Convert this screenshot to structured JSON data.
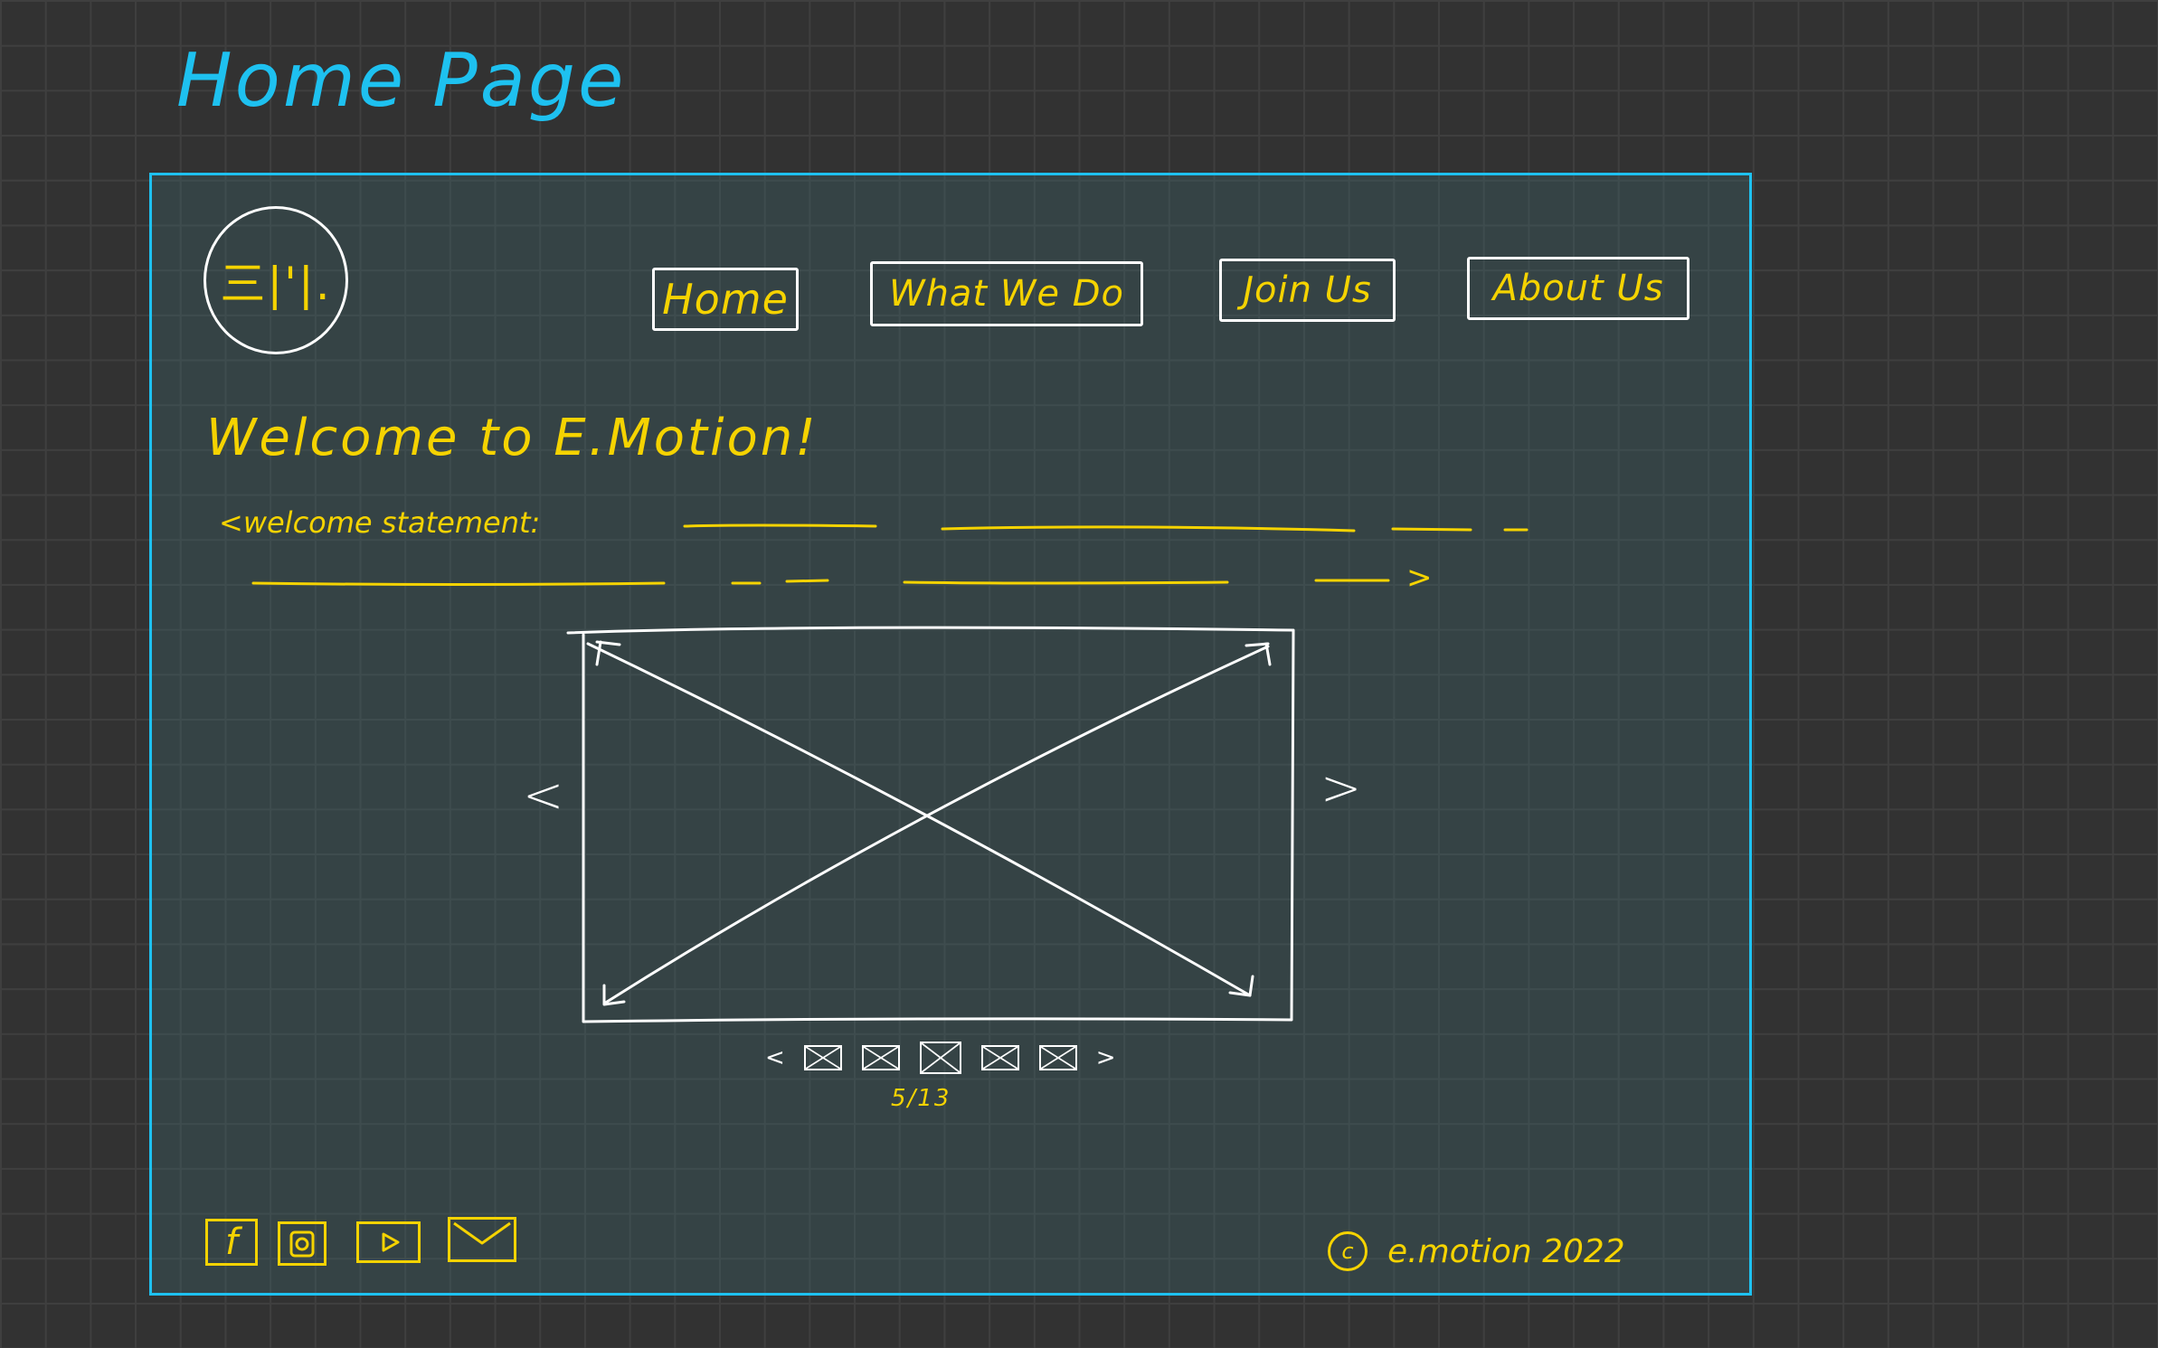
{
  "page_title": "Home Page",
  "logo": {
    "text": "三|'|."
  },
  "nav": {
    "items": [
      {
        "label": "Home"
      },
      {
        "label": "What We Do"
      },
      {
        "label": "Join Us"
      },
      {
        "label": "About Us"
      }
    ]
  },
  "welcome": {
    "heading": "Welcome to E.Motion!",
    "statement": "<welcome statement:",
    "statement_end": ">"
  },
  "carousel": {
    "prev_label": "<",
    "next_label": ">",
    "thumb_prev_label": "<",
    "thumb_next_label": ">",
    "counter": "5/13",
    "current_index": 5,
    "total": 13
  },
  "footer": {
    "social_icons": [
      "facebook-icon",
      "instagram-icon",
      "youtube-icon",
      "mail-icon"
    ],
    "facebook_label": "f",
    "copyright_symbol": "c",
    "copyright_text": "e.motion 2022"
  },
  "colors": {
    "title": "#1ec1f0",
    "frame_border": "#1ec1f0",
    "handwriting": "#f5d300",
    "sketch_lines": "#ffffff",
    "background": "#323232"
  }
}
